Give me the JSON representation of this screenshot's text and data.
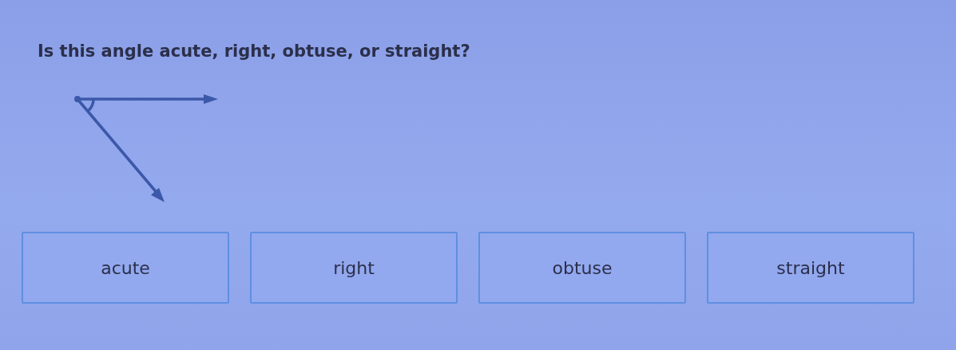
{
  "question": "Is this angle acute, right, obtuse, or straight?",
  "figure": {
    "kind": "angle"
  },
  "choices": [
    "acute",
    "right",
    "obtuse",
    "straight"
  ]
}
